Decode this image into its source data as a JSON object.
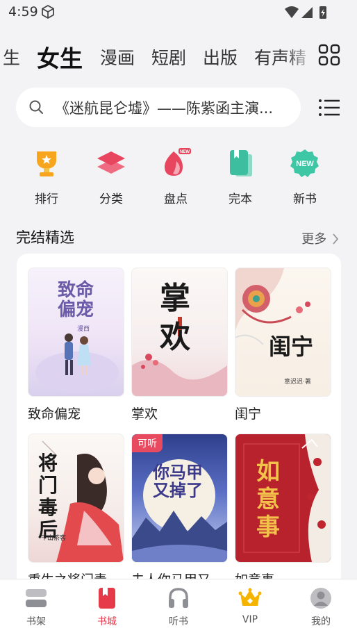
{
  "status": {
    "time": "4:59"
  },
  "tabs": [
    {
      "label": "生"
    },
    {
      "label": "女生"
    },
    {
      "label": "漫画"
    },
    {
      "label": "短剧"
    },
    {
      "label": "出版"
    },
    {
      "label": "有声精"
    }
  ],
  "search": {
    "placeholder": "《迷航昆仑墟》——陈紫函主演..."
  },
  "quick_links": [
    {
      "label": "排行",
      "icon": "trophy-icon"
    },
    {
      "label": "分类",
      "icon": "layers-icon"
    },
    {
      "label": "盘点",
      "icon": "flame-icon",
      "badge": "NEW"
    },
    {
      "label": "完本",
      "icon": "book-icon"
    },
    {
      "label": "新书",
      "icon": "new-badge-icon",
      "badge": "NEW"
    }
  ],
  "section": {
    "title": "完结精选",
    "more": "更多"
  },
  "books": [
    {
      "title": "致命偏宠",
      "cover_text": "致命偏宠",
      "author": "漫西"
    },
    {
      "title": "掌欢",
      "cover_text": "掌欢"
    },
    {
      "title": "闺宁",
      "cover_text": "闺宁",
      "author": "意迟迟·著"
    },
    {
      "title": "重生之将门毒",
      "cover_text": "将门毒后",
      "author": "千山茶客"
    },
    {
      "title": "夫人你马甲又",
      "cover_text": "你马甲又掉了",
      "badge": "可听"
    },
    {
      "title": "如意事",
      "cover_text": "如意事"
    }
  ],
  "bottom_nav": [
    {
      "label": "书架",
      "icon": "bookshelf-icon"
    },
    {
      "label": "书城",
      "icon": "bookstore-icon",
      "active": true
    },
    {
      "label": "听书",
      "icon": "headphones-icon"
    },
    {
      "label": "VIP",
      "icon": "crown-icon"
    },
    {
      "label": "我的",
      "icon": "profile-icon"
    }
  ],
  "colors": {
    "accent": "#e6394a",
    "background": "#f3f3f5"
  }
}
